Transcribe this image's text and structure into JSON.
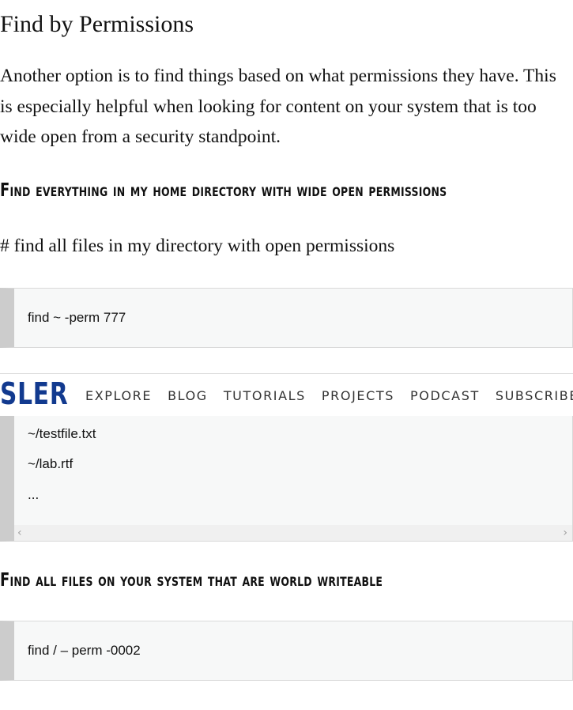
{
  "section": {
    "title": "Find by Permissions",
    "intro": "Another option is to find things based on what permissions they have. This is especially helpful when looking for content on your system that is too wide open from a security standpoint."
  },
  "subsection_wide": {
    "heading": "Find everything in my home directory with wide open permissions",
    "comment": "# find all files in my directory with open permissions",
    "command": "find ~ -perm 777",
    "output": [
      "~/testfile.txt",
      "~/lab.rtf",
      "..."
    ]
  },
  "subsection_world": {
    "heading": "Find all files on your system that are world writeable",
    "command": "find / – perm -0002"
  },
  "navbar": {
    "brand": "SLER",
    "brand_color": "#123a8f",
    "items": [
      "EXPLORE",
      "BLOG",
      "TUTORIALS",
      "PROJECTS",
      "PODCAST",
      "SUBSCRIBE"
    ]
  },
  "scrollbar": {
    "left_icon": "chevron-left-icon",
    "right_icon": "chevron-right-icon"
  }
}
